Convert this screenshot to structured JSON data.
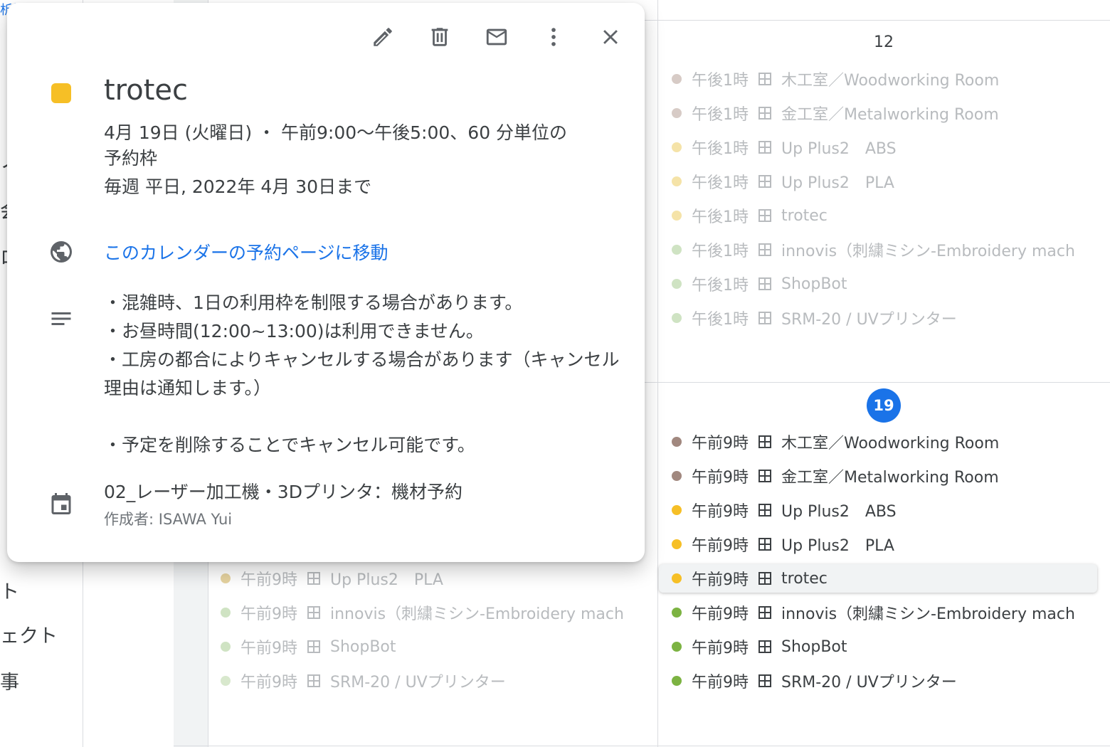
{
  "sidebar": {
    "top_link_fragment": "析情報",
    "fragments": [
      "ノ",
      "会",
      "ロ",
      "・",
      "ト",
      "ェクト",
      "事"
    ]
  },
  "calendar": {
    "day_12": "12",
    "day_19": "19",
    "events_day12": [
      {
        "time": "午後1時",
        "title": "木工室／Woodworking Room",
        "color": "#d7cbc6"
      },
      {
        "time": "午後1時",
        "title": "金工室／Metalworking Room",
        "color": "#d7cbc6"
      },
      {
        "time": "午後1時",
        "title": "Up Plus2　ABS",
        "color": "#f5e3a8"
      },
      {
        "time": "午後1時",
        "title": "Up Plus2　PLA",
        "color": "#f5e3a8"
      },
      {
        "time": "午後1時",
        "title": "trotec",
        "color": "#f5e3a8"
      },
      {
        "time": "午後1時",
        "title": "innovis（刺繍ミシン-Embroidery mach",
        "color": "#cfe3c3"
      },
      {
        "time": "午後1時",
        "title": "ShopBot",
        "color": "#cfe3c3"
      },
      {
        "time": "午後1時",
        "title": "SRM-20 / UVプリンター",
        "color": "#cfe3c3"
      }
    ],
    "events_day18": [
      {
        "time": "午前9時",
        "title": "Up Plus2　PLA",
        "color": "#e6d3a0"
      },
      {
        "time": "午前9時",
        "title": "innovis（刺繍ミシン-Embroidery mach",
        "color": "#cfe3c3"
      },
      {
        "time": "午前9時",
        "title": "ShopBot",
        "color": "#cfe3c3"
      },
      {
        "time": "午前9時",
        "title": "SRM-20 / UVプリンター",
        "color": "#d8e8cd"
      }
    ],
    "events_day19": [
      {
        "time": "午前9時",
        "title": "木工室／Woodworking Room",
        "color": "#a1887f"
      },
      {
        "time": "午前9時",
        "title": "金工室／Metalworking Room",
        "color": "#a1887f"
      },
      {
        "time": "午前9時",
        "title": "Up Plus2　ABS",
        "color": "#f6bf26"
      },
      {
        "time": "午前9時",
        "title": "Up Plus2　PLA",
        "color": "#f6bf26"
      },
      {
        "time": "午前9時",
        "title": "trotec",
        "color": "#f6bf26"
      },
      {
        "time": "午前9時",
        "title": "innovis（刺繍ミシン-Embroidery mach",
        "color": "#7cb342"
      },
      {
        "time": "午前9時",
        "title": "ShopBot",
        "color": "#7cb342"
      },
      {
        "time": "午前9時",
        "title": "SRM-20 / UVプリンター",
        "color": "#7cb342"
      }
    ]
  },
  "popup": {
    "toolbar_icons": [
      "edit-icon",
      "delete-icon",
      "email-icon",
      "more-vert-icon",
      "close-icon"
    ],
    "color": "#f6bf26",
    "title": "trotec",
    "date_line": "4月 19日 (火曜日)  ・  午前9:00～午後5:00、60 分単位の",
    "date_line2": "予約枠",
    "recurrence": "毎週 平日, 2022年 4月 30日まで",
    "booking_link": "このカレンダーの予約ページに移動",
    "description": "・混雑時、1日の利用枠を制限する場合があります。\n・お昼時間(12:00~13:00)は利用できません。\n・工房の都合によりキャンセルする場合があります（キャンセル理由は通知します。）\n\n・予定を削除することでキャンセル可能です。",
    "calendar_name": "02_レーザー加工機・3Dプリンタ：機材予約",
    "creator": "作成者: ISAWA Yui"
  }
}
